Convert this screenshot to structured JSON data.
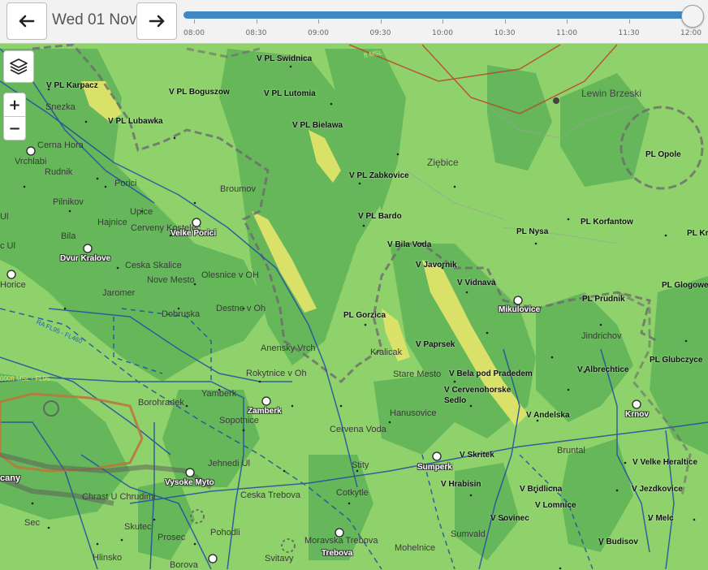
{
  "toolbar": {
    "prev_icon": "arrow-left-icon",
    "next_icon": "arrow-right-icon",
    "date": "Wed 01 Nov",
    "timeline": {
      "ticks": [
        "08:00",
        "08:30",
        "09:00",
        "09:30",
        "10:00",
        "10:30",
        "11:00",
        "11:30",
        "12:00"
      ],
      "progress": 1.0,
      "accent": "#3f88c5"
    }
  },
  "map_controls": {
    "layers_icon": "layers-icon",
    "zoom_in": "+",
    "zoom_out": "−"
  },
  "colors": {
    "terrain_base": "#8fd26b",
    "terrain_dark": "#5fb358",
    "terrain_yellow": "#dfe36a",
    "airspace_blue": "#1f4ea0",
    "airspace_red": "#c0392b",
    "border_gray": "#6b6b6b"
  },
  "waypoints": [
    "V PL Swidnica",
    "V PL Karpacz",
    "V PL Boguszow",
    "V PL Lutomia",
    "V PL Lubawka",
    "V PL Bielawa",
    "V PL Zabkovice",
    "V PL Bardo",
    "V Bila Voda",
    "V Javornik",
    "V Vidnava",
    "V Paprsek",
    "V Bela pod Pradedem",
    "V Cervenohorske Sedlo",
    "V Andelska",
    "V Skritek",
    "V Hrabisin",
    "V Bridlicna",
    "V Lomnice",
    "V Sovinec",
    "V Albrechtice",
    "V Velke Heraltice",
    "V Jezdkovice",
    "V Melc",
    "V Budisov",
    "Ziębice",
    "PL Opole",
    "PL Nysa",
    "PL Korfantow",
    "PL Kr",
    "PL Glogowe",
    "PL Prudnik",
    "PL Glubczyce",
    "PL Gorzica",
    "Jindrichov",
    "Lewin Brzeski"
  ],
  "towns": [
    "Snezka",
    "Cerna Hora",
    "Vrchlabi",
    "Rudnik",
    "Pilnikov",
    "Porici",
    "Broumov",
    "Upice",
    "Hajnice",
    "Cerveny Kostelec",
    "Bila",
    "Ceska Skalice",
    "Nove Mesto",
    "Olesnice v OH",
    "Jaromer",
    "Destne v Oh",
    "Dobruska",
    "Anensky Vrch",
    "Rokytnice v Oh",
    "Kralicak",
    "Stare Mesto",
    "Yamberk",
    "Borohradek",
    "Sopotnice",
    "Hanusovice",
    "Cervena Voda",
    "Jehnedi Ul",
    "Stity",
    "Chrast U Chrudimi",
    "Ceska Trebova",
    "Cotkytle",
    "Skutec",
    "Prosec",
    "Pohodli",
    "Moravska Trebova",
    "Mohelnice",
    "Sumvald",
    "Hlinsko",
    "Svitavy",
    "Borova",
    "Bruntal",
    "Sec",
    "Ul",
    "c Ul",
    "Horice"
  ],
  "airports": [
    "Velke Porici",
    "Dvur Kralove",
    "Mikulovice",
    "Zamberk",
    "Vysoke Myto",
    "Sumperk",
    "Krnov",
    "Trebova"
  ],
  "airspace_labels": [
    "RA FL95 - FL460",
    "000ft MSL - FL95",
    "ft MSL",
    "cany"
  ]
}
